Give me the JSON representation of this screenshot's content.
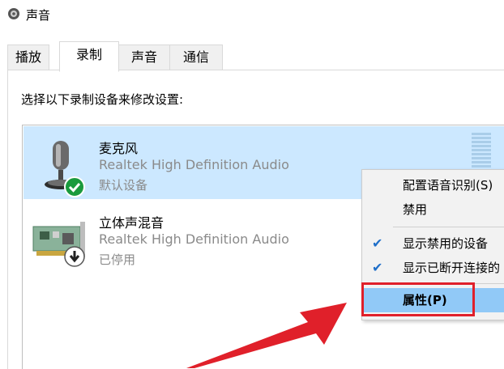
{
  "window": {
    "title": "声音",
    "icon": "speaker-icon"
  },
  "tabs": [
    {
      "label": "播放"
    },
    {
      "label": "录制"
    },
    {
      "label": "声音"
    },
    {
      "label": "通信"
    }
  ],
  "active_tab": "录制",
  "instruction": "选择以下录制设备来修改设置:",
  "devices": [
    {
      "name": "麦克风",
      "description": "Realtek High Definition Audio",
      "status": "默认设备",
      "icon": "microphone-icon",
      "badge": "default-check-icon",
      "selected": true
    },
    {
      "name": "立体声混音",
      "description": "Realtek High Definition Audio",
      "status": "已停用",
      "icon": "sound-card-icon",
      "badge": "disabled-arrow-icon",
      "selected": false
    }
  ],
  "context_menu": {
    "items": [
      {
        "label": "配置语音识别(S)",
        "checked": false
      },
      {
        "label": "禁用",
        "checked": false
      },
      {
        "label": "显示禁用的设备",
        "checked": true
      },
      {
        "label": "显示已断开连接的",
        "checked": true
      },
      {
        "label": "属性(P)",
        "checked": false,
        "highlighted": true
      }
    ]
  },
  "colors": {
    "selection": "#cce8ff",
    "menu_highlight": "#91c9f7",
    "annotation_red": "#e0202a",
    "check_blue": "#1f6fc9"
  }
}
